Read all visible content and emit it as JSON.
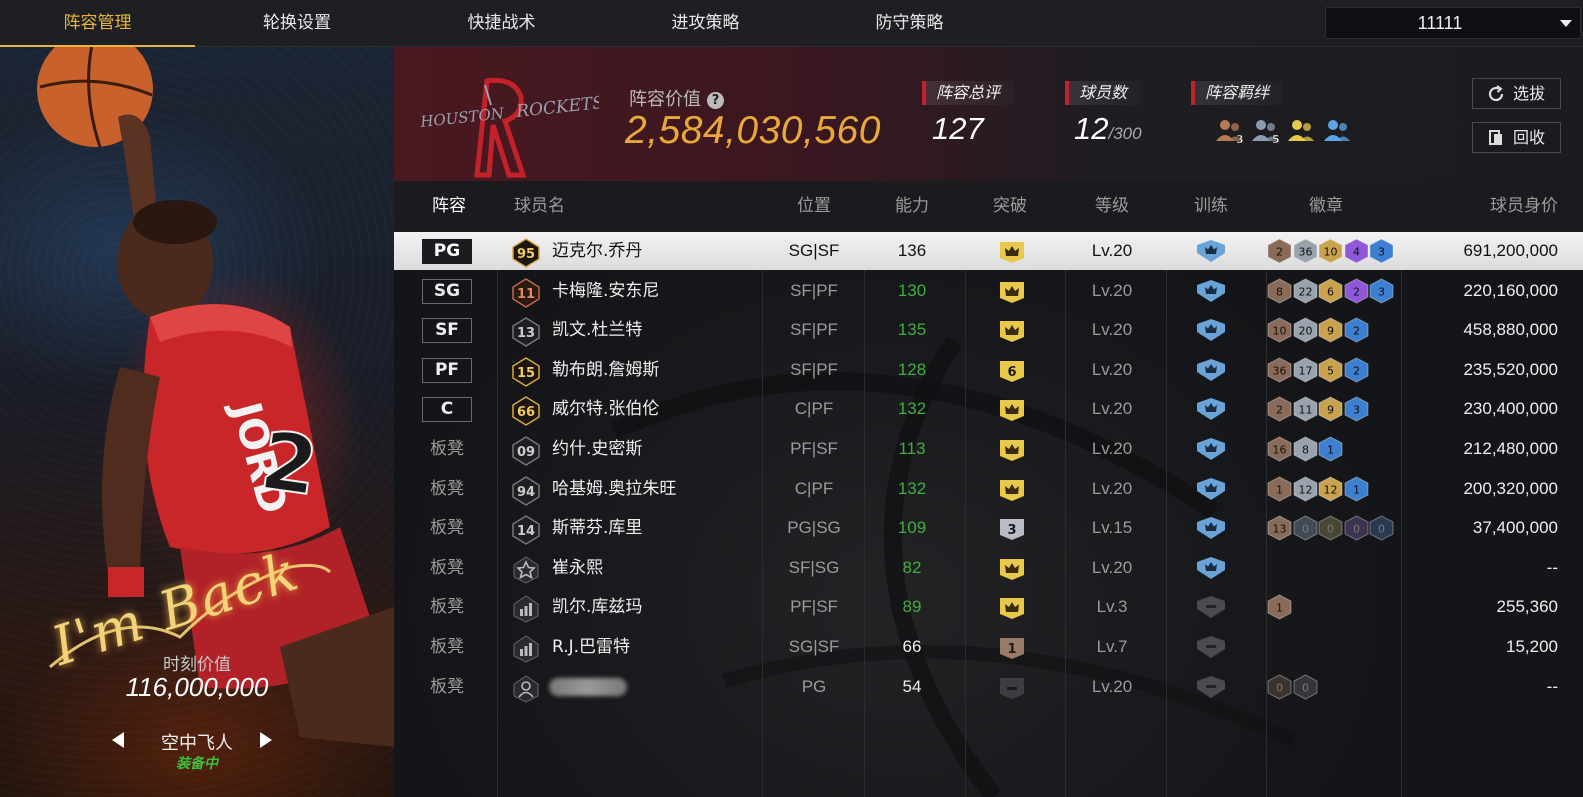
{
  "nav": {
    "tabs": [
      "阵容管理",
      "轮换设置",
      "快捷战术",
      "进攻策略",
      "防守策略"
    ],
    "active_tab": "阵容管理",
    "team_select": "11111"
  },
  "card": {
    "signature": "I'm Back",
    "moment_label": "时刻价值",
    "moment_value": "116,000,000",
    "skin_name": "空中飞人",
    "equipped": "装备中"
  },
  "team": {
    "logo_text": "HOUSTON ROCKETS",
    "value_label": "阵容价值",
    "value": "2,584,030,560",
    "rating_label": "阵容总评",
    "rating": "127",
    "players_label": "球员数",
    "players": "12",
    "players_max": "/300",
    "bond_label": "阵容羁绊",
    "bonds": [
      {
        "num": "3",
        "color": "#b87a52"
      },
      {
        "num": "5",
        "color": "#8d9bb4"
      },
      {
        "num": "",
        "color": "#e9c94a"
      },
      {
        "num": "",
        "color": "#5aa6e8"
      }
    ],
    "draft_button": "选拔",
    "recycle_button": "回收"
  },
  "table": {
    "headers": [
      "阵容",
      "球员名",
      "位置",
      "能力",
      "突破",
      "等级",
      "训练",
      "徽章",
      "球员身价"
    ],
    "rows": [
      {
        "slot": "PG",
        "starter": true,
        "num": "95",
        "num_style": "gold",
        "name": "迈克尔.乔丹",
        "pos": "SG|SF",
        "ability": "136",
        "ability_color": "white",
        "break": "crown",
        "break_color": "#e9c94a",
        "level": "Lv.20",
        "level_dim": false,
        "train": "blue",
        "badges": [
          [
            "2",
            "#8a6a58"
          ],
          [
            "36",
            "#9aa2ae"
          ],
          [
            "10",
            "#c9a24e"
          ],
          [
            "4",
            "#8e58d8"
          ],
          [
            "3",
            "#3d7fd0"
          ]
        ],
        "value": "691,200,000",
        "selected": true
      },
      {
        "slot": "SG",
        "starter": true,
        "num": "11",
        "num_style": "bronze",
        "name": "卡梅隆.安东尼",
        "pos": "SF|PF",
        "ability": "130",
        "ability_color": "green",
        "break": "crown",
        "break_color": "#e9c94a",
        "level": "Lv.20",
        "level_dim": true,
        "train": "blue",
        "badges": [
          [
            "8",
            "#8a6a58"
          ],
          [
            "22",
            "#9aa2ae"
          ],
          [
            "6",
            "#c9a24e"
          ],
          [
            "2",
            "#8e58d8"
          ],
          [
            "3",
            "#3d7fd0"
          ]
        ],
        "value": "220,160,000"
      },
      {
        "slot": "SF",
        "starter": true,
        "num": "13",
        "num_style": "dark",
        "name": "凯文.杜兰特",
        "pos": "SF|PF",
        "ability": "135",
        "ability_color": "green",
        "break": "crown",
        "break_color": "#e9c94a",
        "level": "Lv.20",
        "level_dim": true,
        "train": "blue",
        "badges": [
          [
            "10",
            "#8a6a58"
          ],
          [
            "20",
            "#9aa2ae"
          ],
          [
            "9",
            "#c9a24e"
          ],
          [
            "2",
            "#3d7fd0"
          ]
        ],
        "value": "458,880,000"
      },
      {
        "slot": "PF",
        "starter": true,
        "num": "15",
        "num_style": "gold",
        "name": "勒布朗.詹姆斯",
        "pos": "SF|PF",
        "ability": "128",
        "ability_color": "green",
        "break": "6",
        "break_color": "#e9c94a",
        "level": "Lv.20",
        "level_dim": true,
        "train": "blue",
        "badges": [
          [
            "36",
            "#8a6a58"
          ],
          [
            "17",
            "#9aa2ae"
          ],
          [
            "5",
            "#c9a24e"
          ],
          [
            "2",
            "#3d7fd0"
          ]
        ],
        "value": "235,520,000"
      },
      {
        "slot": "C",
        "starter": true,
        "num": "66",
        "num_style": "gold",
        "name": "威尔特.张伯伦",
        "pos": "C|PF",
        "ability": "132",
        "ability_color": "green",
        "break": "crown",
        "break_color": "#e9c94a",
        "level": "Lv.20",
        "level_dim": true,
        "train": "blue",
        "badges": [
          [
            "2",
            "#8a6a58"
          ],
          [
            "11",
            "#9aa2ae"
          ],
          [
            "9",
            "#c9a24e"
          ],
          [
            "3",
            "#3d7fd0"
          ]
        ],
        "value": "230,400,000"
      },
      {
        "slot": "板凳",
        "starter": false,
        "num": "09",
        "num_style": "dark",
        "name": "约什.史密斯",
        "pos": "PF|SF",
        "ability": "113",
        "ability_color": "green",
        "break": "crown",
        "break_color": "#e9c94a",
        "level": "Lv.20",
        "level_dim": true,
        "train": "blue",
        "badges": [
          [
            "16",
            "#8a6a58"
          ],
          [
            "8",
            "#9aa2ae"
          ],
          [
            "1",
            "#3d7fd0"
          ]
        ],
        "value": "212,480,000"
      },
      {
        "slot": "板凳",
        "starter": false,
        "num": "94",
        "num_style": "dark",
        "name": "哈基姆.奥拉朱旺",
        "pos": "C|PF",
        "ability": "132",
        "ability_color": "green",
        "break": "crown",
        "break_color": "#e9c94a",
        "level": "Lv.20",
        "level_dim": true,
        "train": "blue",
        "badges": [
          [
            "1",
            "#8a6a58"
          ],
          [
            "12",
            "#9aa2ae"
          ],
          [
            "12",
            "#c9a24e"
          ],
          [
            "1",
            "#3d7fd0"
          ]
        ],
        "value": "200,320,000"
      },
      {
        "slot": "板凳",
        "starter": false,
        "num": "14",
        "num_style": "dark",
        "name": "斯蒂芬.库里",
        "pos": "PG|SG",
        "ability": "109",
        "ability_color": "green",
        "break": "3",
        "break_color": "#b9bcc4",
        "level": "Lv.15",
        "level_dim": true,
        "train": "blue",
        "badges": [
          [
            "13",
            "#8a6a58"
          ],
          [
            "0",
            "#444a55"
          ],
          [
            "0",
            "#4b4535"
          ],
          [
            "0",
            "#3d3350"
          ],
          [
            "0",
            "#283a50"
          ]
        ],
        "value": "37,400,000"
      },
      {
        "slot": "板凳",
        "starter": false,
        "num": "star",
        "num_style": "icon",
        "name": "崔永熙",
        "pos": "SF|SG",
        "ability": "82",
        "ability_color": "green",
        "break": "crown",
        "break_color": "#e9c94a",
        "level": "Lv.20",
        "level_dim": true,
        "train": "blue",
        "badges": [],
        "value": "--"
      },
      {
        "slot": "板凳",
        "starter": false,
        "num": "bars",
        "num_style": "icon",
        "name": "凯尔.库兹玛",
        "pos": "PF|SF",
        "ability": "89",
        "ability_color": "green",
        "break": "crown",
        "break_color": "#e9c94a",
        "level": "Lv.3",
        "level_dim": true,
        "train": "grey",
        "badges": [
          [
            "1",
            "#8a6a58"
          ]
        ],
        "value": "255,360"
      },
      {
        "slot": "板凳",
        "starter": false,
        "num": "bars",
        "num_style": "icon",
        "name": "R.J.巴雷特",
        "pos": "SG|SF",
        "ability": "66",
        "ability_color": "white",
        "break": "1",
        "break_color": "#9a7a68",
        "level": "Lv.7",
        "level_dim": true,
        "train": "grey",
        "badges": [],
        "value": "15,200"
      },
      {
        "slot": "板凳",
        "starter": false,
        "num": "person",
        "num_style": "icon",
        "name": "",
        "pos": "PG",
        "ability": "54",
        "ability_color": "white",
        "break": "dash",
        "break_color": "#3c3d42",
        "level": "Lv.20",
        "level_dim": true,
        "train": "grey",
        "badges": [
          [
            "0",
            "#3a3330"
          ],
          [
            "0",
            "#34363b"
          ]
        ],
        "value": "--",
        "blurred": true
      }
    ]
  }
}
